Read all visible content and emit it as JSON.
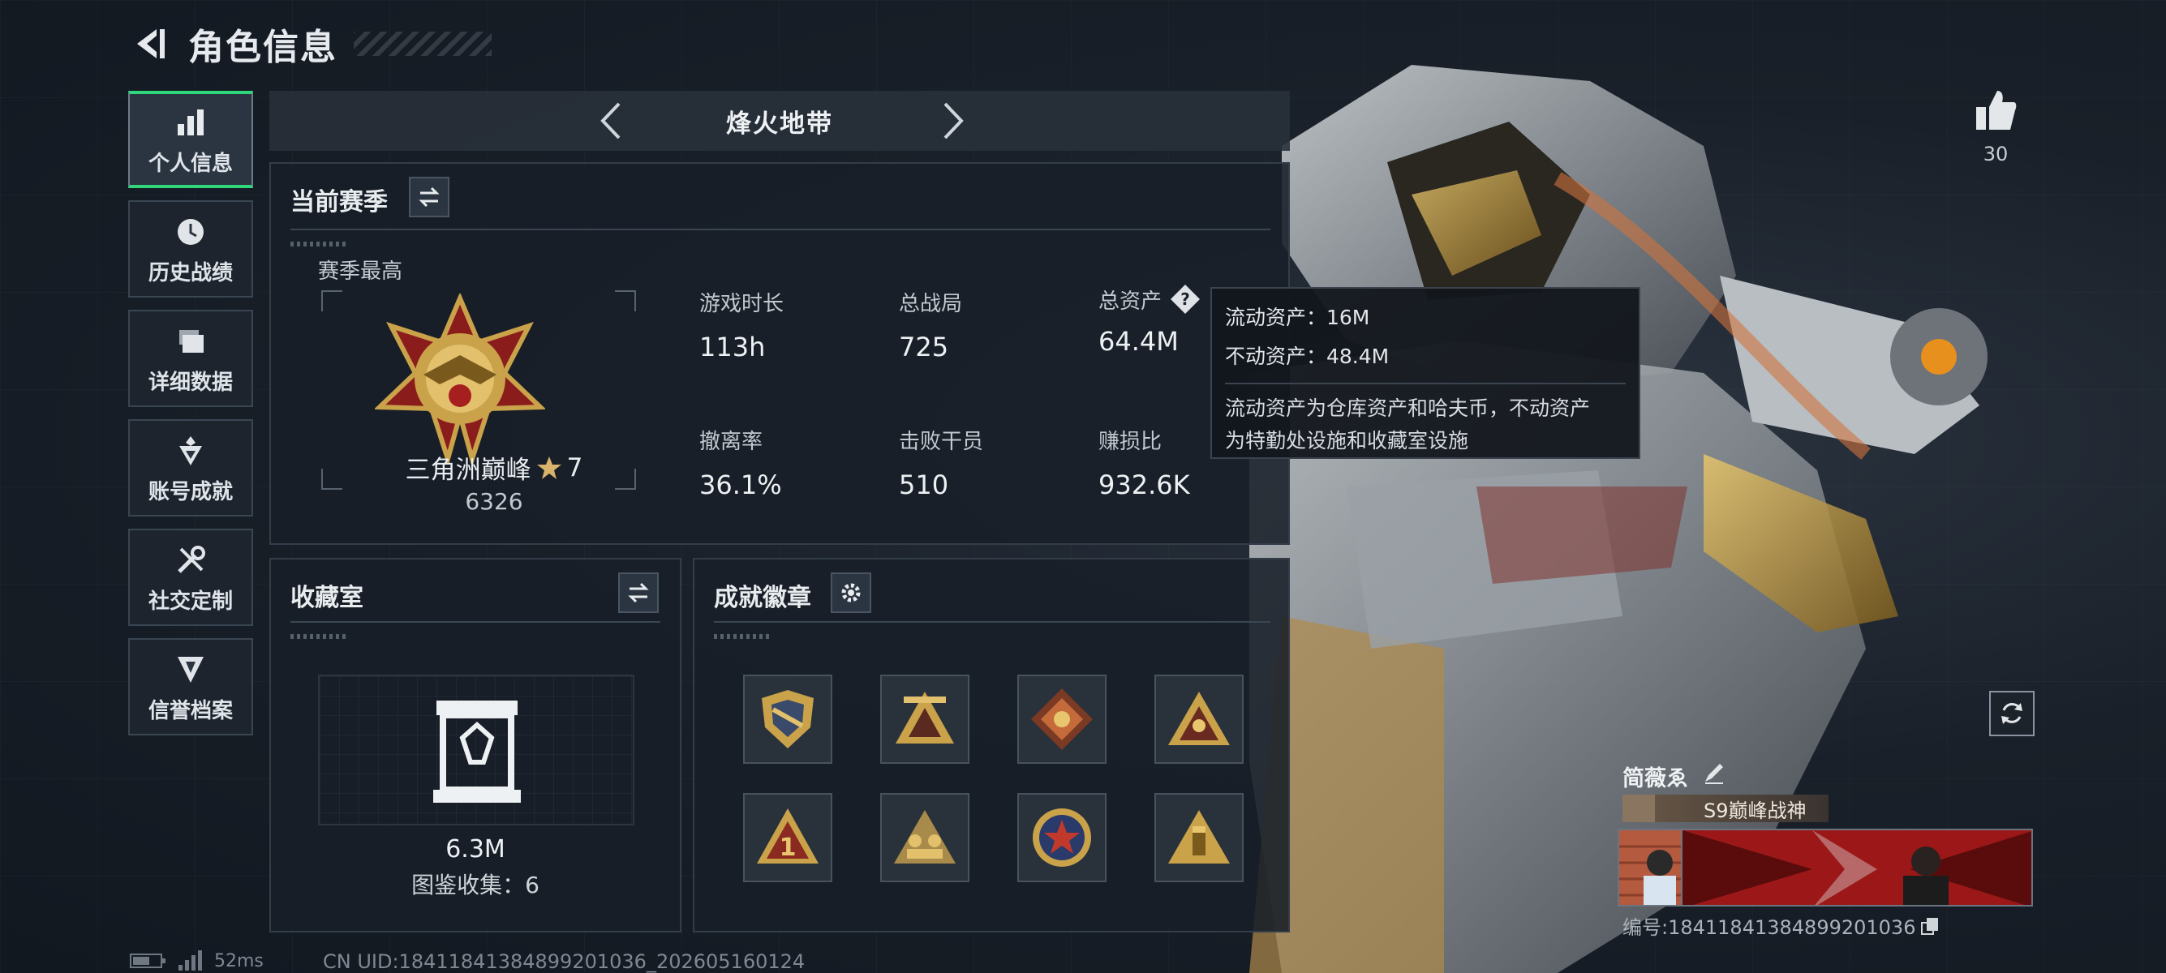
{
  "header": {
    "title": "角色信息"
  },
  "sidebar": {
    "items": [
      {
        "label": "个人信息",
        "icon": "bar-chart-icon",
        "active": true
      },
      {
        "label": "历史战绩",
        "icon": "clock-icon",
        "active": false
      },
      {
        "label": "详细数据",
        "icon": "folder-icon",
        "active": false
      },
      {
        "label": "账号成就",
        "icon": "achievement-icon",
        "active": false
      },
      {
        "label": "社交定制",
        "icon": "tools-icon",
        "active": false
      },
      {
        "label": "信誉档案",
        "icon": "credit-icon",
        "active": false
      }
    ]
  },
  "mode": {
    "title": "烽火地带"
  },
  "season": {
    "title": "当前赛季",
    "subtitle": "赛季最高",
    "rank_name": "三角洲巅峰",
    "rank_stars": "7",
    "rank_score": "6326",
    "stats": [
      {
        "label": "游戏时长",
        "value": "113h"
      },
      {
        "label": "总战局",
        "value": "725"
      },
      {
        "label": "总资产",
        "value": "64.4M"
      },
      {
        "label": "撤离率",
        "value": "36.1%"
      },
      {
        "label": "击败干员",
        "value": "510"
      },
      {
        "label": "赚损比",
        "value": "932.6K"
      }
    ]
  },
  "tooltip": {
    "liquid": "流动资产：16M",
    "fixed": "不动资产：48.4M",
    "desc_line1": "流动资产为仓库资产和哈夫币，不动资产",
    "desc_line2": "为特勤处设施和收藏室设施"
  },
  "collection": {
    "title": "收藏室",
    "value": "6.3M",
    "count_label": "图鉴收集：6"
  },
  "badges": {
    "title": "成就徽章",
    "items": [
      "shield-badge",
      "pyramid-badge",
      "dragon-badge",
      "triangle-squad-badge",
      "rank-one-badge",
      "team-badge",
      "star-medal-badge",
      "ammo-badge"
    ]
  },
  "profile": {
    "likes": "30",
    "name": "简薇ゑ",
    "title_badge": "S9巅峰战神",
    "id_text": "编号:18411841384899201036"
  },
  "status": {
    "ping": "52ms",
    "uid": "CN UID:18411841384899201036_202605160124"
  },
  "colors": {
    "accent_green": "#2fd67a",
    "panel_bg": "#181f28",
    "gold": "#c9a24a"
  }
}
